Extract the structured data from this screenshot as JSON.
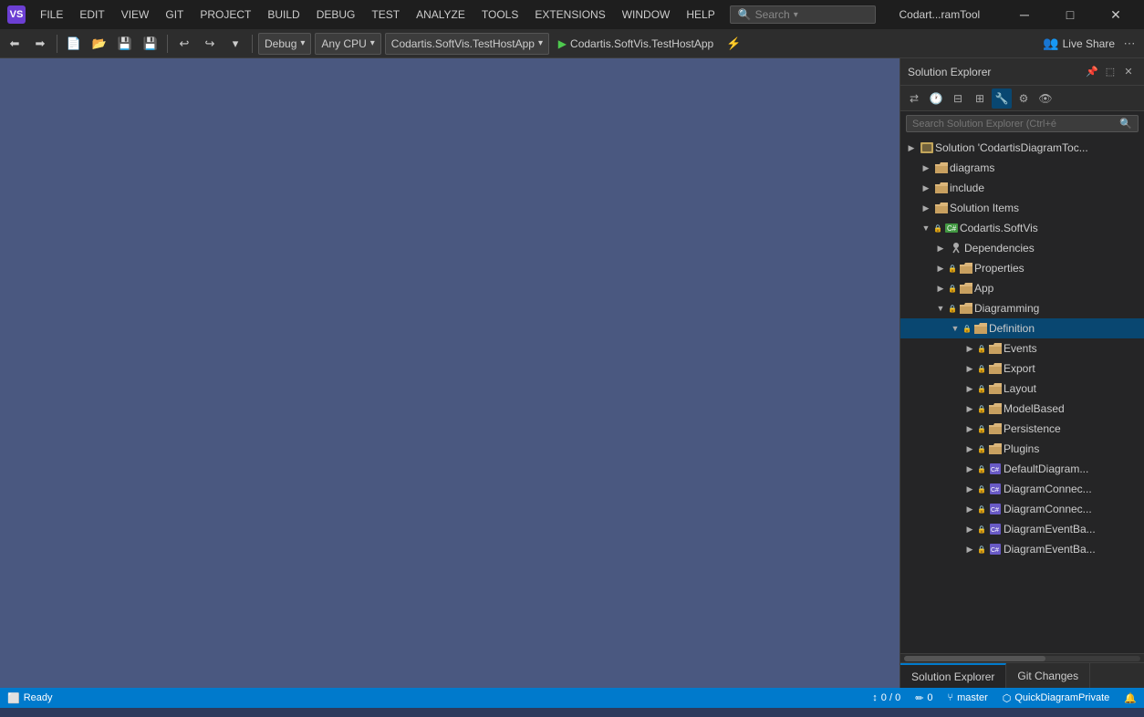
{
  "titlebar": {
    "logo": "VS",
    "menu_items": [
      "FILE",
      "EDIT",
      "VIEW",
      "GIT",
      "PROJECT",
      "BUILD",
      "DEBUG",
      "TEST",
      "ANALYZE",
      "TOOLS",
      "EXTENSIONS",
      "WINDOW",
      "HELP"
    ],
    "search_placeholder": "Search",
    "window_title": "Codart...ramTool",
    "min_label": "─",
    "max_label": "□",
    "close_label": "✕"
  },
  "toolbar": {
    "debug_config": "Debug",
    "cpu_config": "Any CPU",
    "project_config": "Codartis.SoftVis.TestHostApp",
    "run_label": "Codartis.SoftVis.TestHostApp",
    "live_share_label": "Live Share"
  },
  "solution_explorer": {
    "title": "Solution Explorer",
    "search_placeholder": "Search Solution Explorer (Ctrl+é",
    "tree": [
      {
        "id": "solution",
        "label": "Solution 'CodartisDiagramToc...",
        "level": 0,
        "expanded": true,
        "type": "solution",
        "arrow": "▶"
      },
      {
        "id": "diagrams",
        "label": "diagrams",
        "level": 1,
        "expanded": false,
        "type": "folder",
        "arrow": "▶"
      },
      {
        "id": "include",
        "label": "include",
        "level": 1,
        "expanded": false,
        "type": "folder",
        "arrow": "▶"
      },
      {
        "id": "solution-items",
        "label": "Solution Items",
        "level": 1,
        "expanded": false,
        "type": "folder",
        "arrow": "▶"
      },
      {
        "id": "codartis-softvis",
        "label": "Codartis.SoftVis",
        "level": 1,
        "expanded": true,
        "type": "project",
        "arrow": "▼",
        "lock": true
      },
      {
        "id": "dependencies",
        "label": "Dependencies",
        "level": 2,
        "expanded": false,
        "type": "dep",
        "arrow": "▶"
      },
      {
        "id": "properties",
        "label": "Properties",
        "level": 2,
        "expanded": false,
        "type": "folder",
        "arrow": "▶",
        "lock": true
      },
      {
        "id": "app",
        "label": "App",
        "level": 2,
        "expanded": false,
        "type": "folder",
        "arrow": "▶",
        "lock": true
      },
      {
        "id": "diagramming",
        "label": "Diagramming",
        "level": 2,
        "expanded": true,
        "type": "folder",
        "arrow": "▼",
        "lock": true
      },
      {
        "id": "definition",
        "label": "Definition",
        "level": 3,
        "expanded": true,
        "type": "folder",
        "arrow": "▼",
        "lock": true
      },
      {
        "id": "events",
        "label": "Events",
        "level": 4,
        "expanded": false,
        "type": "folder",
        "arrow": "▶",
        "lock": true
      },
      {
        "id": "export",
        "label": "Export",
        "level": 4,
        "expanded": false,
        "type": "folder",
        "arrow": "▶",
        "lock": true
      },
      {
        "id": "layout",
        "label": "Layout",
        "level": 4,
        "expanded": false,
        "type": "folder",
        "arrow": "▶",
        "lock": true
      },
      {
        "id": "modelbased",
        "label": "ModelBased",
        "level": 4,
        "expanded": false,
        "type": "folder",
        "arrow": "▶",
        "lock": true
      },
      {
        "id": "persistence",
        "label": "Persistence",
        "level": 4,
        "expanded": false,
        "type": "folder",
        "arrow": "▶",
        "lock": true
      },
      {
        "id": "plugins",
        "label": "Plugins",
        "level": 4,
        "expanded": false,
        "type": "folder",
        "arrow": "▶",
        "lock": true
      },
      {
        "id": "defaultdiagram",
        "label": "DefaultDiagram...",
        "level": 4,
        "expanded": false,
        "type": "cs",
        "arrow": "▶",
        "lock": true
      },
      {
        "id": "diagramconnec1",
        "label": "DiagramConnec...",
        "level": 4,
        "expanded": false,
        "type": "cs",
        "arrow": "▶",
        "lock": true
      },
      {
        "id": "diagramconnec2",
        "label": "DiagramConnec...",
        "level": 4,
        "expanded": false,
        "type": "cs",
        "arrow": "▶",
        "lock": true
      },
      {
        "id": "diagrameventb1",
        "label": "DiagramEventBa...",
        "level": 4,
        "expanded": false,
        "type": "cs",
        "arrow": "▶",
        "lock": true
      },
      {
        "id": "diagrameventb2",
        "label": "DiagramEventBa...",
        "level": 4,
        "expanded": false,
        "type": "cs",
        "arrow": "▶",
        "lock": true
      }
    ]
  },
  "bottom_tabs": {
    "tabs": [
      "Solution Explorer",
      "Git Changes"
    ]
  },
  "status_bar": {
    "ready": "Ready",
    "line_col": "0 / 0",
    "errors": "0",
    "branch": "master",
    "project": "QuickDiagramPrivate",
    "notification": "🔔"
  }
}
